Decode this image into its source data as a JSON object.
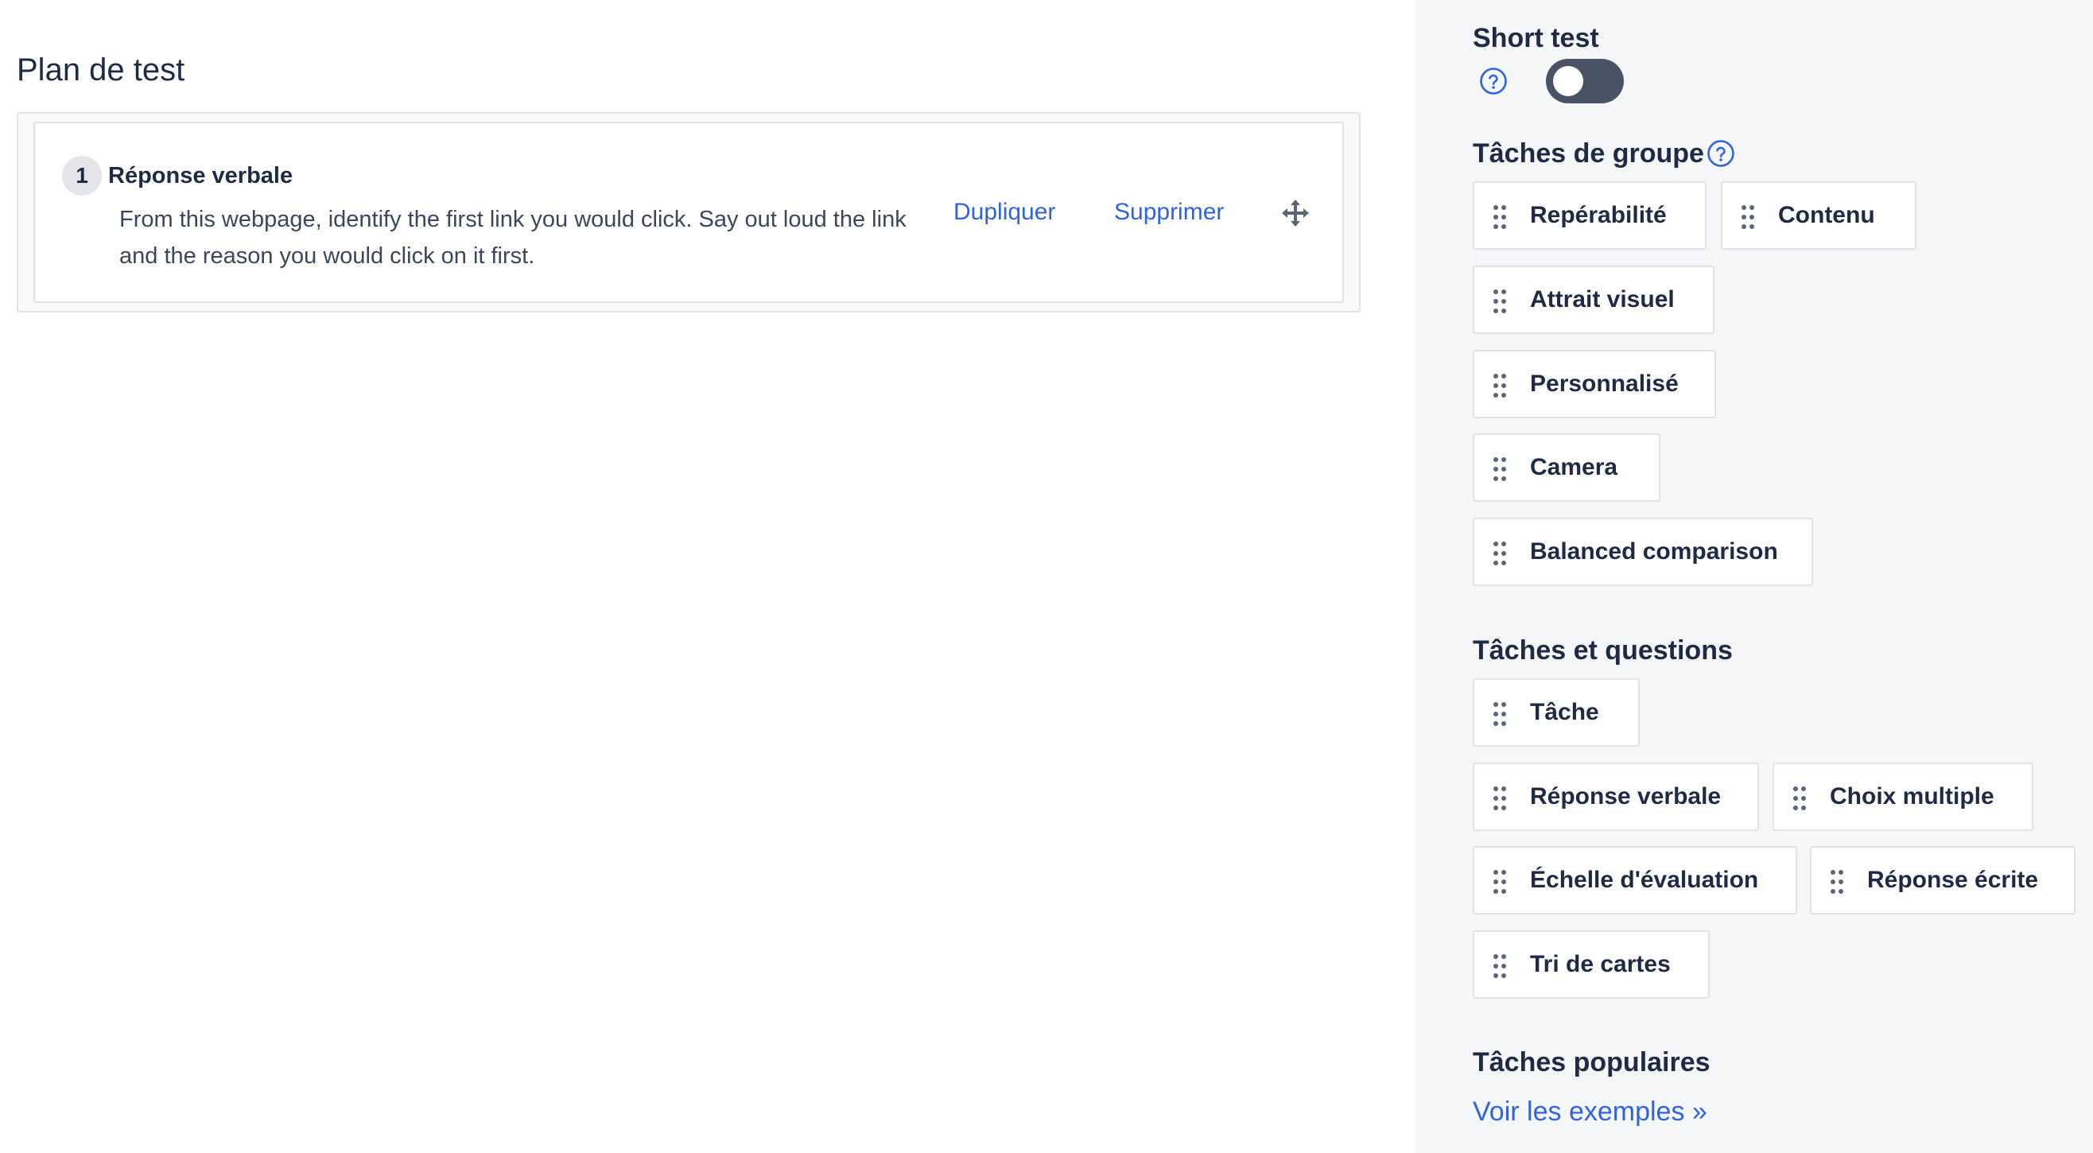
{
  "main": {
    "title": "Plan de test",
    "tasks": [
      {
        "number": "1",
        "title": "Réponse verbale",
        "description": "From this webpage, identify the first link you would click. Say out loud the link and the reason you would click on it first.",
        "duplicate_label": "Dupliquer",
        "delete_label": "Supprimer"
      }
    ]
  },
  "sidebar": {
    "short_test": {
      "label": "Short test",
      "enabled": false
    },
    "group_tasks": {
      "heading": "Tâches de groupe",
      "items": [
        "Repérabilité",
        "Contenu",
        "Attrait visuel",
        "Personnalisé",
        "Camera",
        "Balanced comparison"
      ]
    },
    "tasks_questions": {
      "heading": "Tâches et questions",
      "items": [
        "Tâche",
        "Réponse verbale",
        "Choix multiple",
        "Échelle d'évaluation",
        "Réponse écrite",
        "Tri de cartes"
      ]
    },
    "popular_tasks": {
      "heading": "Tâches populaires",
      "link_label": "Voir les exemples »"
    }
  },
  "colors": {
    "accent": "#2f63e0",
    "text": "#1f2a44",
    "sidebar_bg": "#f5f6f8",
    "toggle_off": "#4a5366"
  }
}
